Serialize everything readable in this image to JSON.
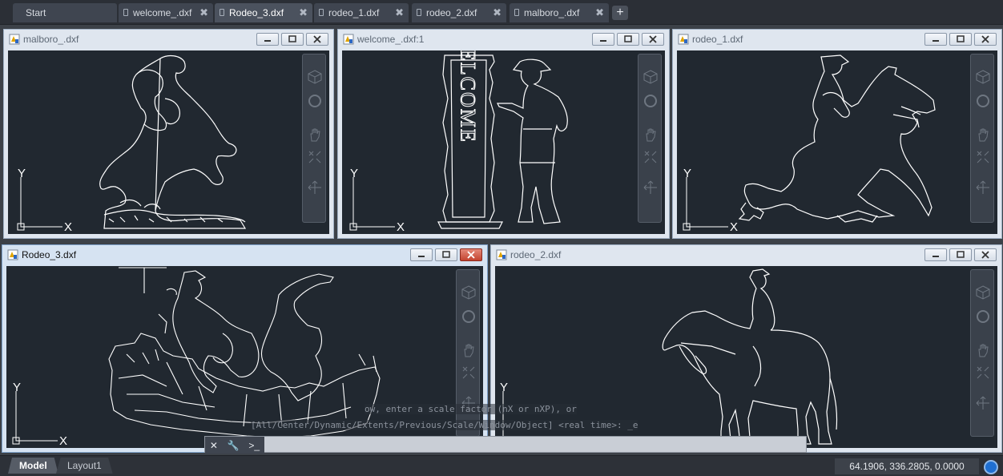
{
  "tabs": [
    {
      "label": "Start",
      "active": false
    },
    {
      "label": "welcome_.dxf",
      "active": false
    },
    {
      "label": "Rodeo_3.dxf",
      "active": true
    },
    {
      "label": "rodeo_1.dxf",
      "active": false
    },
    {
      "label": "rodeo_2.dxf",
      "active": false
    },
    {
      "label": "malboro_.dxf",
      "active": false
    }
  ],
  "viewports": [
    {
      "title": "malboro_.dxf"
    },
    {
      "title": "welcome_.dxf:1"
    },
    {
      "title": "rodeo_1.dxf"
    },
    {
      "title": "Rodeo_3.dxf"
    },
    {
      "title": "rodeo_2.dxf"
    }
  ],
  "ucs": {
    "x_label": "X",
    "y_label": "Y"
  },
  "welcome_sign_text": "WELCOME",
  "command_line": {
    "line1": "ow, enter a scale factor (nX or nXP), or",
    "line2": "[All/Center/Dynamic/Extents/Previous/Scale/Window/Object] <real time>: _e"
  },
  "layout_tabs": [
    {
      "label": "Model",
      "active": true
    },
    {
      "label": "Layout1",
      "active": false
    }
  ],
  "status": {
    "coordinates": "64.1906, 336.2805, 0.0000"
  },
  "colors": {
    "canvas": "#212830",
    "drawing": "#ffffff",
    "accent": "#1f6fd1"
  }
}
